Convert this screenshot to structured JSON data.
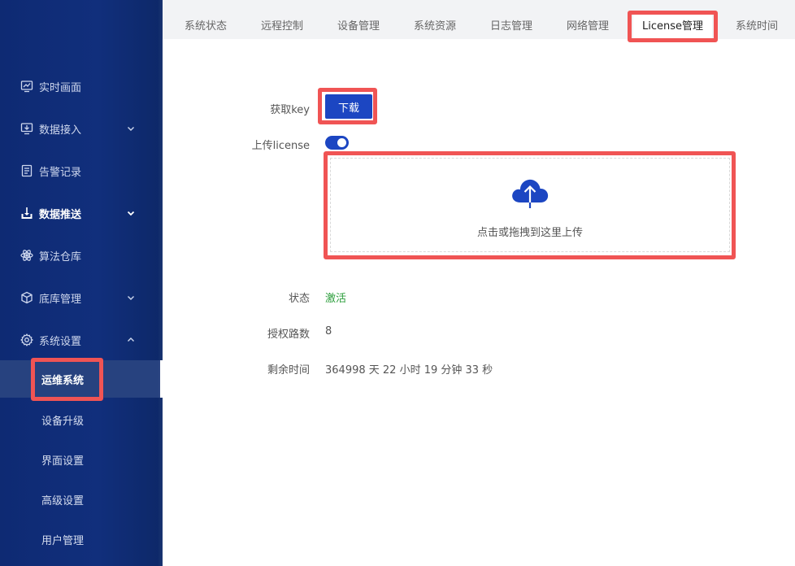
{
  "sidebar": {
    "items": [
      {
        "label": "实时画面",
        "icon": "monitor-chart-icon"
      },
      {
        "label": "数据接入",
        "icon": "desktop-download-icon"
      },
      {
        "label": "告警记录",
        "icon": "document-list-icon"
      },
      {
        "label": "数据推送",
        "icon": "upload-tray-icon"
      },
      {
        "label": "算法仓库",
        "icon": "atom-icon"
      },
      {
        "label": "底库管理",
        "icon": "cube-icon"
      },
      {
        "label": "系统设置",
        "icon": "gear-icon"
      }
    ],
    "sub_items": [
      {
        "label": "运维系统"
      },
      {
        "label": "设备升级"
      },
      {
        "label": "界面设置"
      },
      {
        "label": "高级设置"
      },
      {
        "label": "用户管理"
      }
    ]
  },
  "tabs": [
    {
      "label": "系统状态"
    },
    {
      "label": "远程控制"
    },
    {
      "label": "设备管理"
    },
    {
      "label": "系统资源"
    },
    {
      "label": "日志管理"
    },
    {
      "label": "网络管理"
    },
    {
      "label": "License管理"
    },
    {
      "label": "系统时间"
    }
  ],
  "form": {
    "get_key_label": "获取key",
    "download_button": "下载",
    "upload_label": "上传license",
    "upload_enabled": true,
    "dropzone_hint": "点击或拖拽到这里上传",
    "status_label": "状态",
    "status_value": "激活",
    "channels_label": "授权路数",
    "channels_value": "8",
    "remaining_label": "剩余时间",
    "remaining_value": "364998 天 22 小时 19 分钟 33 秒"
  },
  "colors": {
    "primary": "#1c46c2",
    "sidebar": "#112f7c",
    "status_active": "#2a9d3a",
    "highlight": "#f05454"
  }
}
